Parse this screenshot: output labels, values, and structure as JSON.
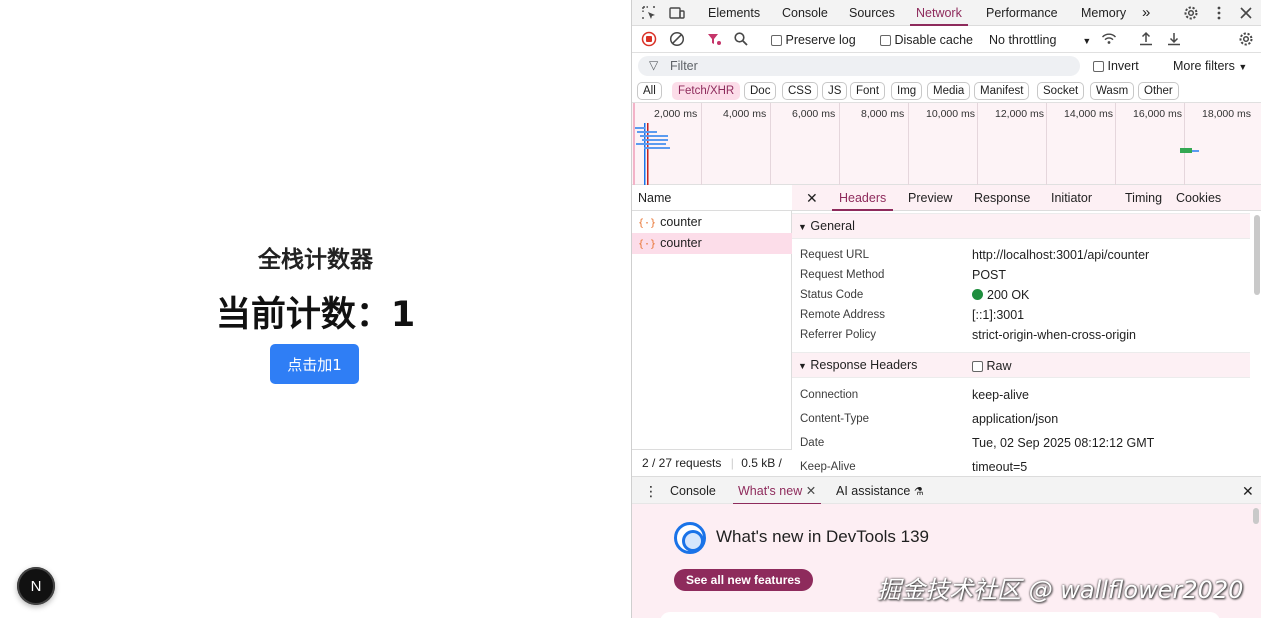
{
  "app": {
    "title": "全栈计数器",
    "count_text": "当前计数：1",
    "button_label": "点击加1",
    "badge_letter": "N"
  },
  "devtools": {
    "main_tabs": [
      "Elements",
      "Console",
      "Sources",
      "Network",
      "Performance",
      "Memory"
    ],
    "active_main_tab": "Network",
    "more_tabs_icon": "»",
    "toolbar": {
      "preserve_log": "Preserve log",
      "disable_cache": "Disable cache",
      "throttling": "No throttling"
    },
    "filter": {
      "placeholder": "Filter",
      "invert": "Invert",
      "more_filters": "More filters"
    },
    "type_filters": [
      "All",
      "Fetch/XHR",
      "Doc",
      "CSS",
      "JS",
      "Font",
      "Img",
      "Media",
      "Manifest",
      "Socket",
      "Wasm",
      "Other"
    ],
    "active_type_filter": "Fetch/XHR",
    "timeline_ticks": [
      "2,000 ms",
      "4,000 ms",
      "6,000 ms",
      "8,000 ms",
      "10,000 ms",
      "12,000 ms",
      "14,000 ms",
      "16,000 ms",
      "18,000 ms"
    ],
    "name_header": "Name",
    "requests": [
      {
        "icon": "{·}",
        "name": "counter"
      },
      {
        "icon": "{·}",
        "name": "counter"
      }
    ],
    "status": {
      "requests": "2 / 27 requests",
      "size": "0.5 kB /"
    },
    "detail_tabs": [
      "Headers",
      "Preview",
      "Response",
      "Initiator",
      "Timing",
      "Cookies"
    ],
    "active_detail_tab": "Headers",
    "general": {
      "title": "General",
      "rows": [
        {
          "key": "Request URL",
          "value": "http://localhost:3001/api/counter"
        },
        {
          "key": "Request Method",
          "value": "POST"
        },
        {
          "key": "Status Code",
          "value": "200 OK"
        },
        {
          "key": "Remote Address",
          "value": "[::1]:3001"
        },
        {
          "key": "Referrer Policy",
          "value": "strict-origin-when-cross-origin"
        }
      ]
    },
    "response_headers": {
      "title": "Response Headers",
      "raw_label": "Raw",
      "rows": [
        {
          "key": "Connection",
          "value": "keep-alive"
        },
        {
          "key": "Content-Type",
          "value": "application/json"
        },
        {
          "key": "Date",
          "value": "Tue, 02 Sep 2025 08:12:12 GMT"
        },
        {
          "key": "Keep-Alive",
          "value": "timeout=5"
        }
      ]
    },
    "drawer": {
      "tabs": [
        "Console",
        "What's new",
        "AI assistance"
      ],
      "active_tab": "What's new",
      "whats_new_title": "What's new in DevTools 139",
      "see_all_button": "See all new features"
    }
  },
  "watermark": "掘金技术社区 @ wallflower2020",
  "colors": {
    "accent": "#8e2b5c",
    "button_blue": "#2f7ef5",
    "status_green": "#1e8e3e",
    "selected_row": "#fcdde9"
  }
}
